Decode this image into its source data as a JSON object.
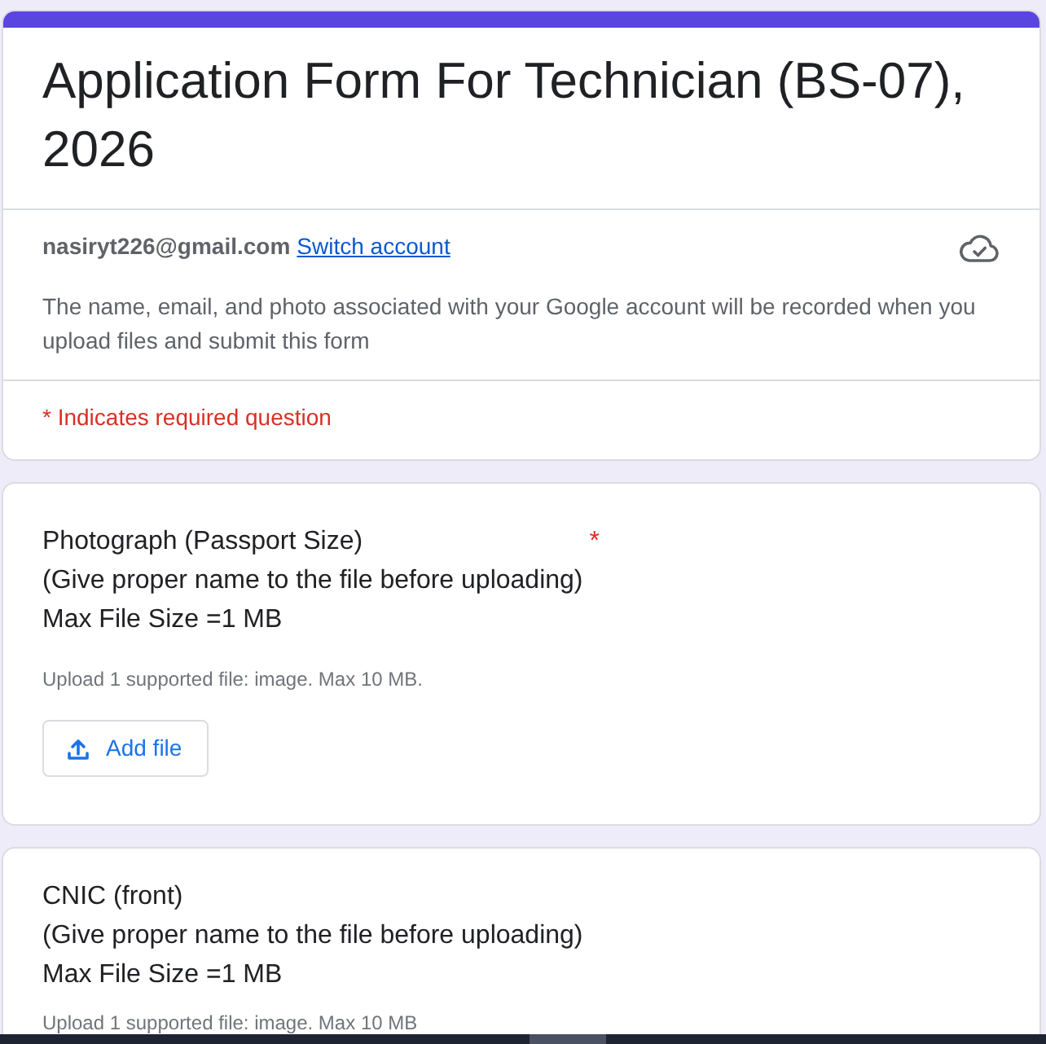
{
  "form_header": {
    "title": "Application Form For Technician (BS-07), 2026",
    "account_email": "nasiryt226@gmail.com",
    "switch_account": "Switch account",
    "notice": "The name, email, and photo associated with your Google account will be recorded when you upload files and submit this form",
    "required_note": "* Indicates required question"
  },
  "questions": [
    {
      "title_lines": [
        "Photograph (Passport Size)",
        "(Give proper name to the file before uploading)",
        "Max File Size =1 MB"
      ],
      "required_mark": "*",
      "hint": "Upload 1 supported file: image. Max 10 MB.",
      "button": "Add file"
    },
    {
      "title_lines": [
        "CNIC (front)",
        "(Give proper name to the file before uploading)",
        "Max File Size =1 MB"
      ],
      "hint": "Upload 1 supported file: image. Max 10 MB"
    }
  ]
}
